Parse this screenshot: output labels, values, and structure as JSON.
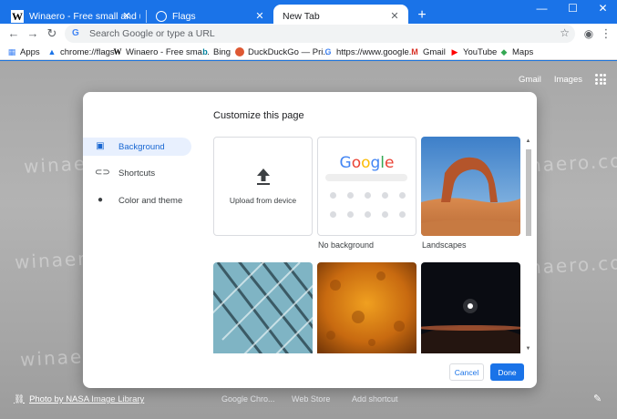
{
  "tabs": [
    {
      "title": "Winaero - Free small and useful",
      "icon": "winaero-icon"
    },
    {
      "title": "Flags",
      "icon": "globe-icon"
    },
    {
      "title": "New Tab",
      "icon": ""
    }
  ],
  "window_controls": {
    "minimize": "—",
    "maximize": "☐",
    "close": "✕"
  },
  "new_tab_symbol": "+",
  "omnibox": {
    "placeholder": "Search Google or type a URL"
  },
  "bookmarks": [
    {
      "label": "Apps",
      "icon": "apps-icon",
      "color": "#4285f4"
    },
    {
      "label": "chrome://flags",
      "icon": "flags-icon",
      "color": "#1a73e8"
    },
    {
      "label": "Winaero - Free sma...",
      "icon": "winaero-icon",
      "color": "#000000"
    },
    {
      "label": "Bing",
      "icon": "bing-icon",
      "color": "#00809d"
    },
    {
      "label": "DuckDuckGo — Pri...",
      "icon": "duckduckgo-icon",
      "color": "#de5833"
    },
    {
      "label": "https://www.google...",
      "icon": "google-icon",
      "color": "#4285f4"
    },
    {
      "label": "Gmail",
      "icon": "gmail-icon",
      "color": "#d93025"
    },
    {
      "label": "YouTube",
      "icon": "youtube-icon",
      "color": "#ff0000"
    },
    {
      "label": "Maps",
      "icon": "maps-icon",
      "color": "#34a853"
    }
  ],
  "top_links": {
    "gmail": "Gmail",
    "images": "Images"
  },
  "watermark": "winaero.com",
  "dialog": {
    "title": "Customize this page",
    "menu": [
      {
        "label": "Background",
        "icon": "image-icon",
        "selected": true
      },
      {
        "label": "Shortcuts",
        "icon": "link-icon",
        "selected": false
      },
      {
        "label": "Color and theme",
        "icon": "palette-icon",
        "selected": false
      }
    ],
    "tiles": [
      {
        "label": "Upload from device"
      },
      {
        "label": "No background"
      },
      {
        "label": "Landscapes"
      }
    ],
    "google_logo": "Google",
    "cancel": "Cancel",
    "done": "Done"
  },
  "bottom": {
    "photo_credit": "Photo by NASA Image Library",
    "shortcuts": [
      "Google Chro...",
      "Web Store",
      "Add shortcut"
    ]
  },
  "colors": {
    "accent": "#1a73e8",
    "selected_bg": "#e8f0fe"
  }
}
